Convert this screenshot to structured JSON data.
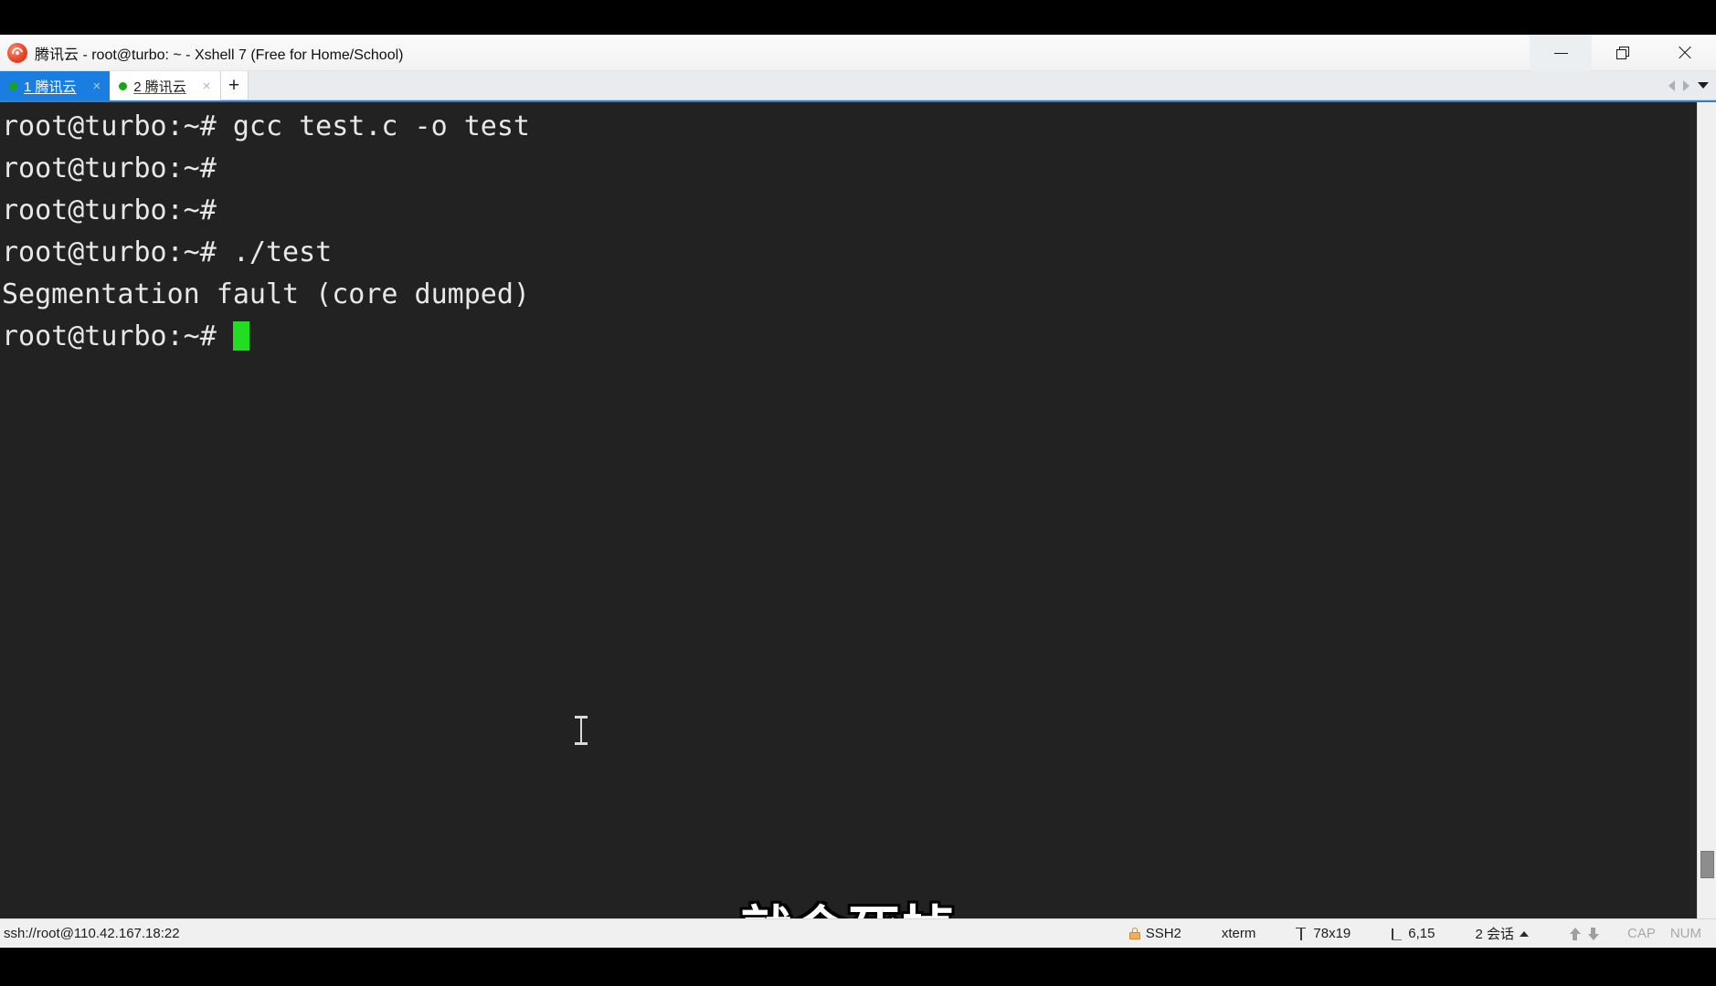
{
  "window": {
    "title": "腾讯云 - root@turbo: ~ - Xshell 7 (Free for Home/School)",
    "app_icon": "tencent-cloud-shell-icon",
    "controls": {
      "minimize": "—",
      "restore": "❐",
      "close": "✕"
    }
  },
  "tabbar": {
    "tabs": [
      {
        "label": "1 腾讯云",
        "active": true,
        "status": "connected",
        "close": "×"
      },
      {
        "label": "2 腾讯云",
        "active": false,
        "status": "connected",
        "close": "×"
      }
    ],
    "new_tab": "+",
    "scroll_left": "◀",
    "scroll_right": "▶",
    "tab_list": "▼"
  },
  "terminal": {
    "background": "#222222",
    "foreground": "#e8e8e8",
    "cursor_color": "#22dd22",
    "lines": [
      "root@turbo:~# gcc test.c -o test",
      "root@turbo:~#",
      "root@turbo:~#",
      "root@turbo:~# ./test",
      "Segmentation fault (core dumped)"
    ],
    "prompt_line": "root@turbo:~# ",
    "cursor": "█"
  },
  "subtitle": {
    "text": "就会死掉"
  },
  "statusbar": {
    "connection": "ssh://root@110.42.167.18:22",
    "protocol": "SSH2",
    "terminal_type": "xterm",
    "screen_size": "78x19",
    "cursor_position": "6,15",
    "sessions": "2 会话",
    "sessions_arrow": "▲",
    "cap_indicator": "CAP",
    "num_indicator": "NUM"
  }
}
